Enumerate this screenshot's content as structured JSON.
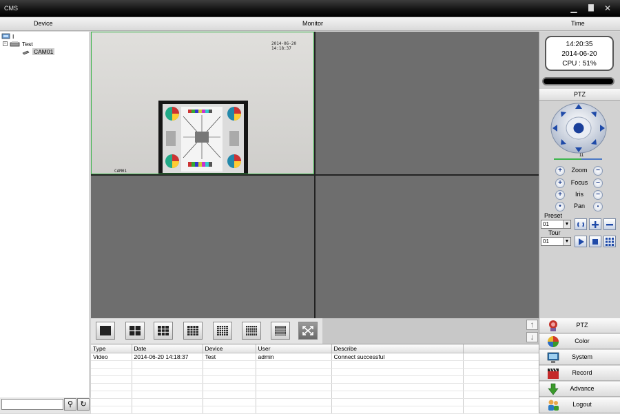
{
  "window": {
    "title": "CMS"
  },
  "header": {
    "device_label": "Device",
    "monitor_label": "Monitor",
    "time_label": "Time"
  },
  "device_tree": [
    {
      "label": "I",
      "icon": "network-icon"
    },
    {
      "label": "Test",
      "icon": "dvr-icon"
    },
    {
      "label": "CAM01",
      "icon": "camera-icon"
    }
  ],
  "search": {
    "value": "",
    "placeholder": ""
  },
  "monitor": {
    "camera_osd_name": "CAM01",
    "camera_osd_timestamp": "2014-06-20 14:18:37"
  },
  "layout_buttons": [
    "1x1",
    "2x2",
    "3x3",
    "4x4",
    "5x5",
    "6x6",
    "8x8",
    "fullscreen"
  ],
  "log": {
    "columns": [
      "Type",
      "Date",
      "Device",
      "User",
      "Describe"
    ],
    "rows": [
      {
        "type": "Video",
        "date": "2014-06-20 14:18:37",
        "device": "Test",
        "user": "admin",
        "describe": "Connect successful"
      }
    ]
  },
  "status": {
    "time": "14:20:35",
    "date": "2014-06-20",
    "cpu": "CPU : 51%"
  },
  "ptz": {
    "title": "PTZ",
    "speed_value": "11",
    "zoom_label": "Zoom",
    "focus_label": "Focus",
    "iris_label": "Iris",
    "pan_label": "Pan",
    "preset_label": "Preset",
    "preset_value": "01",
    "tour_label": "Tour",
    "tour_value": "01"
  },
  "menu": [
    {
      "label": "PTZ",
      "icon": "ptz-icon",
      "color": "#c4322a"
    },
    {
      "label": "Color",
      "icon": "color-palette-icon",
      "color": "#4a8a2a"
    },
    {
      "label": "System",
      "icon": "system-monitor-icon",
      "color": "#2a6aa5"
    },
    {
      "label": "Record",
      "icon": "record-clapper-icon",
      "color": "#c42a2a"
    },
    {
      "label": "Advance",
      "icon": "advance-arrow-icon",
      "color": "#3a9a2a"
    },
    {
      "label": "Logout",
      "icon": "logout-users-icon",
      "color": "#2a7ac4"
    }
  ]
}
